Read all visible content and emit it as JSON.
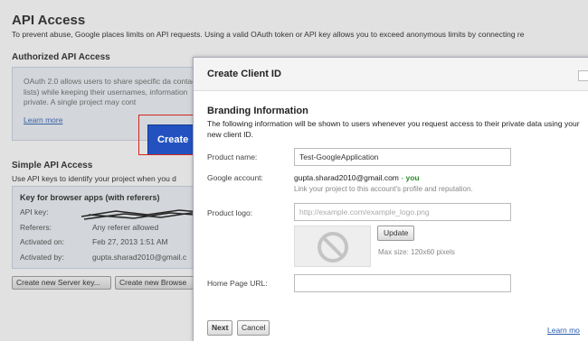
{
  "page": {
    "title": "API Access",
    "subtitle": "To prevent abuse, Google places limits on API requests. Using a valid OAuth token or API key allows you to exceed anonymous limits by connecting re"
  },
  "authorized": {
    "heading": "Authorized API Access",
    "text": "OAuth 2.0 allows users to share specific da contact lists) while keeping their usernames, information private. A single project may cont",
    "learn_more": "Learn more",
    "create_button": "Create"
  },
  "simple": {
    "heading": "Simple API Access",
    "subtitle": "Use API keys to identify your project when you d",
    "box_title": "Key for browser apps (with referers)",
    "rows": [
      {
        "key": "API key:",
        "value": ""
      },
      {
        "key": "Referers:",
        "value": "Any referer allowed"
      },
      {
        "key": "Activated on:",
        "value": "Feb 27, 2013 1:51 AM"
      },
      {
        "key": "Activated by:",
        "value": "gupta.sharad2010@gmail.c"
      }
    ],
    "btn_server_key": "Create new Server key...",
    "btn_browser_key": "Create new Browse"
  },
  "dialog": {
    "title": "Create Client ID",
    "branding_title": "Branding Information",
    "branding_desc": "The following information will be shown to users whenever you request access to their private data using your new client ID.",
    "product_name_label": "Product name:",
    "product_name_value": "Test-GoogleApplication",
    "google_account_label": "Google account:",
    "google_account_email": "gupta.sharad2010@gmail.com",
    "google_account_sep": " - ",
    "google_account_you": "you",
    "google_account_hint": "Link your project to this account's profile and reputation.",
    "product_logo_label": "Product logo:",
    "product_logo_placeholder": "http://example.com/example_logo.png",
    "update_button": "Update",
    "max_size": "Max size: 120x60 pixels",
    "home_page_label": "Home Page URL:",
    "home_page_value": "",
    "next_button": "Next",
    "cancel_button": "Cancel",
    "learn_more": "Learn mo"
  },
  "colors": {
    "primary_button": "#1f4bb5",
    "highlight_box": "#d4251c",
    "link": "#2a5db0",
    "you_badge": "#2e8b2e"
  }
}
